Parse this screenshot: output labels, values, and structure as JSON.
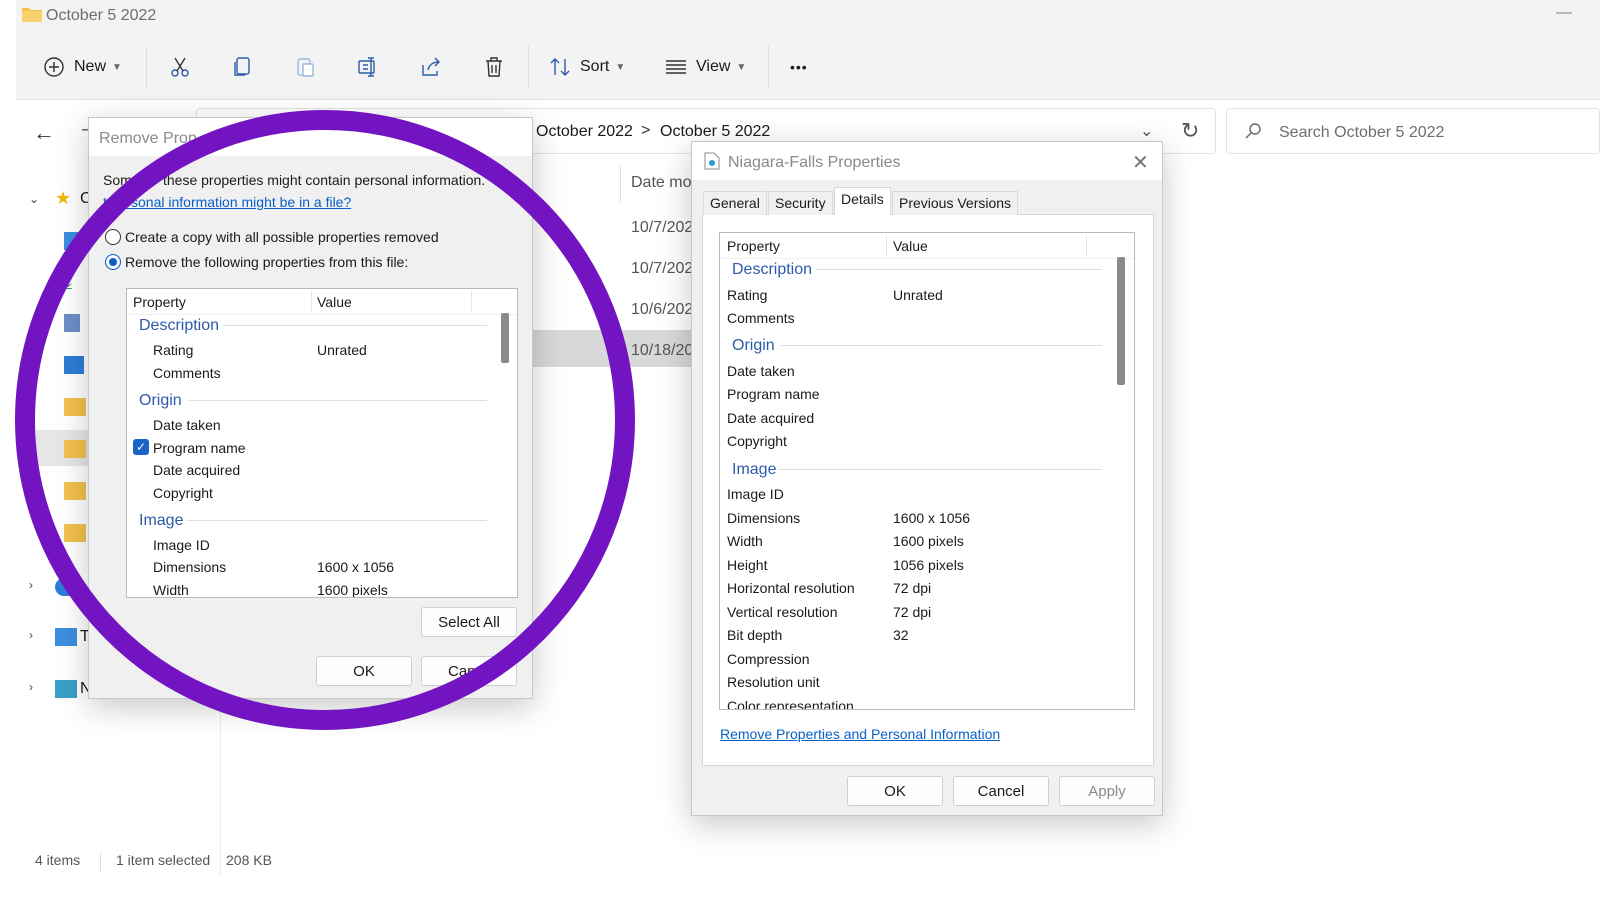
{
  "window": {
    "title": "October 5 2022",
    "minimize_glyph": "—"
  },
  "toolbar": {
    "new_label": "New",
    "sort_label": "Sort",
    "view_label": "View",
    "more_label": "•••"
  },
  "address": {
    "crumbs": [
      "October 2022",
      "October 5 2022"
    ],
    "separator": ">",
    "search_placeholder": "Search October 5 2022"
  },
  "sidebar": {
    "partial_labels": {
      "quick": "C",
      "this_pc": "T",
      "network": "N"
    }
  },
  "file_list": {
    "column_header": "Date mo",
    "dates": [
      "10/7/202",
      "10/7/202",
      "10/6/202",
      "10/18/20"
    ]
  },
  "status": {
    "items": "4 items",
    "selected": "1 item selected",
    "size": "208 KB"
  },
  "remove_dialog": {
    "title": "Remove Prop",
    "intro_a": "Som",
    "intro_b": "these properties might contain personal information.",
    "link": "t personal information might be in a file?",
    "option_copy": "Create a copy with all possible properties removed",
    "option_remove": "Remove the following properties from this file:",
    "col_property": "Property",
    "col_value": "Value",
    "groups": {
      "description": "Description",
      "origin": "Origin",
      "image": "Image"
    },
    "rows": {
      "rating": "Rating",
      "rating_value": "Unrated",
      "comments": "Comments",
      "date_taken": "Date taken",
      "program_name": "Program name",
      "date_acquired": "Date acquired",
      "copyright": "Copyright",
      "image_id": "Image ID",
      "dimensions": "Dimensions",
      "dimensions_value": "1600 x 1056",
      "width": "Width",
      "width_value": "1600 pixels"
    },
    "select_all": "Select All",
    "ok": "OK",
    "cancel": "Can"
  },
  "props_dialog": {
    "title": "Niagara-Falls Properties",
    "tabs": [
      "General",
      "Security",
      "Details",
      "Previous Versions"
    ],
    "col_property": "Property",
    "col_value": "Value",
    "groups": {
      "description": "Description",
      "origin": "Origin",
      "image": "Image"
    },
    "rows": {
      "rating": "Rating",
      "rating_value": "Unrated",
      "comments": "Comments",
      "date_taken": "Date taken",
      "program_name": "Program name",
      "date_acquired": "Date acquired",
      "copyright": "Copyright",
      "image_id": "Image ID",
      "dimensions": "Dimensions",
      "dimensions_value": "1600 x 1056",
      "width": "Width",
      "width_value": "1600 pixels",
      "height": "Height",
      "height_value": "1056 pixels",
      "hres": "Horizontal resolution",
      "hres_value": "72 dpi",
      "vres": "Vertical resolution",
      "vres_value": "72 dpi",
      "bitdepth": "Bit depth",
      "bitdepth_value": "32",
      "compression": "Compression",
      "resunit": "Resolution unit",
      "colorrep": "Color representation"
    },
    "remove_link": "Remove Properties and Personal Information",
    "ok": "OK",
    "cancel": "Cancel",
    "apply": "Apply"
  },
  "colors": {
    "ring": "#7214c2",
    "link": "#0a5fc7",
    "group": "#2d5aa8",
    "folder": "#f2c14e"
  }
}
